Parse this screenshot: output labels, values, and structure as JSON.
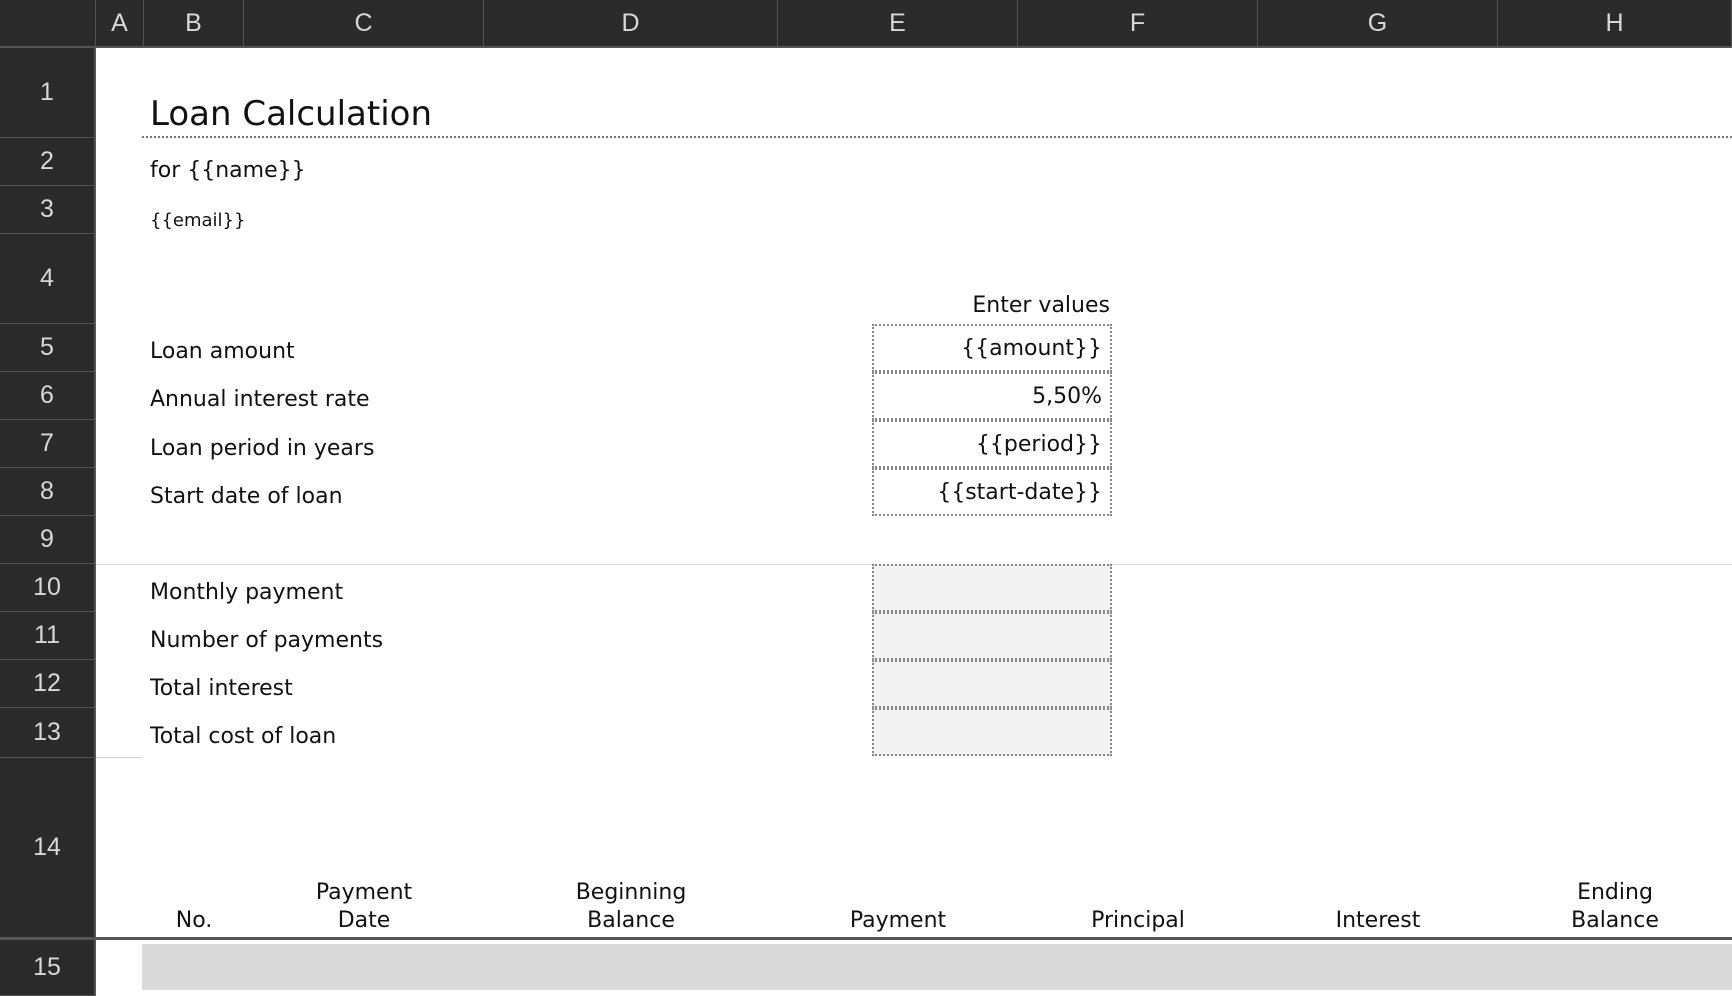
{
  "columns": [
    "A",
    "B",
    "C",
    "D",
    "E",
    "F",
    "G",
    "H"
  ],
  "rows": [
    "1",
    "2",
    "3",
    "4",
    "5",
    "6",
    "7",
    "8",
    "9",
    "10",
    "11",
    "12",
    "13",
    "14",
    "15"
  ],
  "sheet": {
    "title": "Loan Calculation",
    "subtitle": "for {{name}}",
    "email": "{{email}}",
    "enter_values": "Enter values",
    "inputs": [
      {
        "label": "Loan amount",
        "value": "{{amount}}"
      },
      {
        "label": "Annual interest rate",
        "value": "5,50%"
      },
      {
        "label": "Loan period in years",
        "value": "{{period}}"
      },
      {
        "label": "Start date of loan",
        "value": "{{start-date}}"
      }
    ],
    "outputs": [
      {
        "label": "Monthly payment",
        "value": ""
      },
      {
        "label": "Number of payments",
        "value": ""
      },
      {
        "label": "Total interest",
        "value": ""
      },
      {
        "label": "Total cost of loan",
        "value": ""
      }
    ],
    "table_headers": [
      "No.",
      "Payment\nDate",
      "Beginning\nBalance",
      "Payment",
      "Principal",
      "Interest",
      "Ending\nBalance"
    ]
  },
  "colors": {
    "header_bg": "#2b2b2b",
    "header_text": "#d8d8d8",
    "output_fill": "#f2f2f2",
    "row15_fill": "#d9d9d9"
  }
}
